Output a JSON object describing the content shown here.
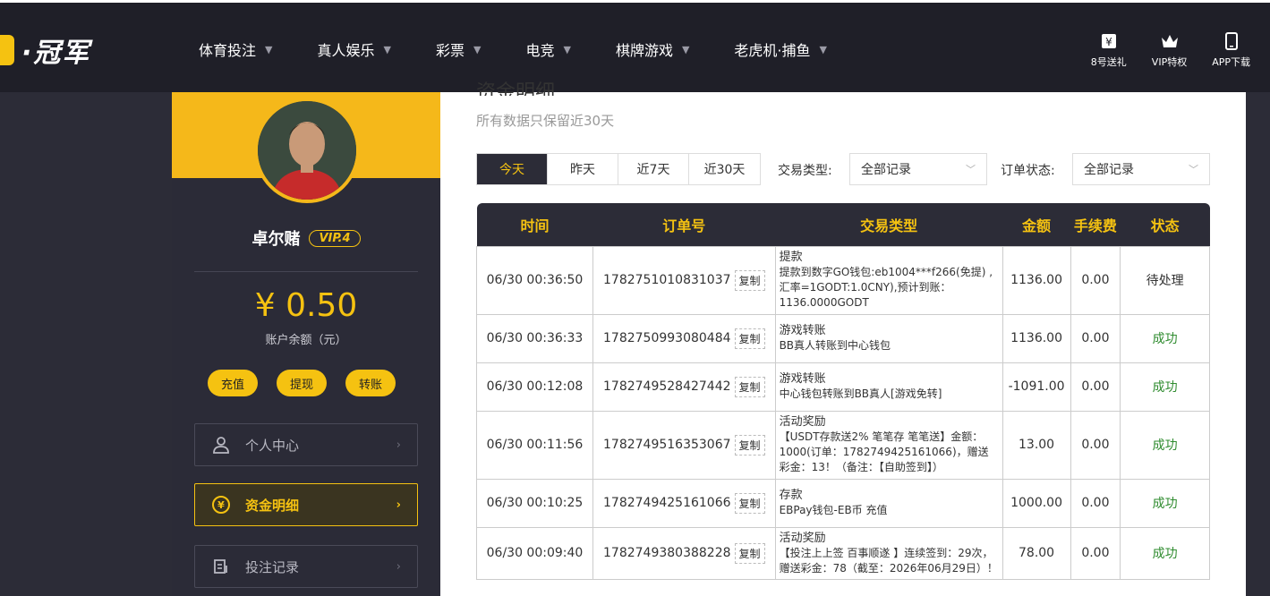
{
  "brand": {
    "logo_text": "·冠军"
  },
  "nav": {
    "items": [
      "体育投注",
      "真人娱乐",
      "彩票",
      "电竞",
      "棋牌游戏",
      "老虎机·捕鱼"
    ]
  },
  "header_right": {
    "gift_label": "8号送礼",
    "vip_label": "VIP特权",
    "app_label": "APP下载"
  },
  "sidebar": {
    "username": "卓尔赌",
    "vip_badge": "VIP.4",
    "balance": "¥ 0.50",
    "balance_label": "账户余额（元）",
    "actions": [
      "充值",
      "提现",
      "转账"
    ],
    "menu": {
      "personal": "个人中心",
      "funds": "资金明细",
      "bets": "投注记录"
    }
  },
  "main": {
    "title": "资金明细",
    "notice": "所有数据只保留近30天",
    "tabs": [
      "今天",
      "昨天",
      "近7天",
      "近30天"
    ],
    "filters": {
      "type_label": "交易类型:",
      "type_value": "全部记录",
      "status_label": "订单状态:",
      "status_value": "全部记录"
    },
    "table": {
      "headers": [
        "时间",
        "订单号",
        "交易类型",
        "金额",
        "手续费",
        "状态"
      ],
      "copy_label": "复制",
      "rows": [
        {
          "time": "06/30 00:36:50",
          "order": "1782751010831037",
          "type_title": "提款",
          "type_detail": "提款到数字GO钱包:eb1004***f266(免提) ,汇率=1GODT:1.0CNY),预计到账：1136.0000GODT",
          "amount": "1136.00",
          "fee": "0.00",
          "status": "待处理"
        },
        {
          "time": "06/30 00:36:33",
          "order": "1782750993080484",
          "type_title": "游戏转账",
          "type_detail": "BB真人转账到中心钱包",
          "amount": "1136.00",
          "fee": "0.00",
          "status": "成功"
        },
        {
          "time": "06/30 00:12:08",
          "order": "1782749528427442",
          "type_title": "游戏转账",
          "type_detail": "中心钱包转账到BB真人[游戏免转]",
          "amount": "-1091.00",
          "fee": "0.00",
          "status": "成功"
        },
        {
          "time": "06/30 00:11:56",
          "order": "1782749516353067",
          "type_title": "活动奖励",
          "type_detail": "【USDT存款送2% 笔笔存 笔笔送】金额：1000(订单：1782749425161066)，赠送彩金：13！（备注：【自助签到】）",
          "amount": "13.00",
          "fee": "0.00",
          "status": "成功"
        },
        {
          "time": "06/30 00:10:25",
          "order": "1782749425161066",
          "type_title": "存款",
          "type_detail": "EBPay钱包-EB币 充值",
          "amount": "1000.00",
          "fee": "0.00",
          "status": "成功"
        },
        {
          "time": "06/30 00:09:40",
          "order": "1782749380388228",
          "type_title": "活动奖励",
          "type_detail": "【投注上上签 百事顺遂 】连续签到：29次，赠送彩金：78（截至：2026年06月29日）！",
          "amount": "78.00",
          "fee": "0.00",
          "status": "成功"
        }
      ]
    }
  },
  "colors": {
    "accent": "#f5c211",
    "dark": "#2c2c37",
    "success": "#2e8b2e"
  }
}
